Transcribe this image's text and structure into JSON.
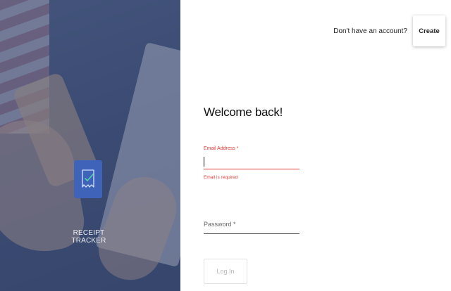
{
  "hero": {
    "app_name": "RECEIPT TRACKER",
    "logo_icon": "receipt-check-icon",
    "tile_color": "#3e63b8"
  },
  "header": {
    "prompt": "Don't have an account?",
    "create_label": "Create"
  },
  "form": {
    "title": "Welcome back!",
    "email": {
      "label": "Email Address *",
      "value": "",
      "error": "Email is required"
    },
    "password": {
      "placeholder": "Password *",
      "value": ""
    },
    "login_label": "Log In"
  },
  "colors": {
    "error": "#e53935",
    "heading": "#111111"
  }
}
